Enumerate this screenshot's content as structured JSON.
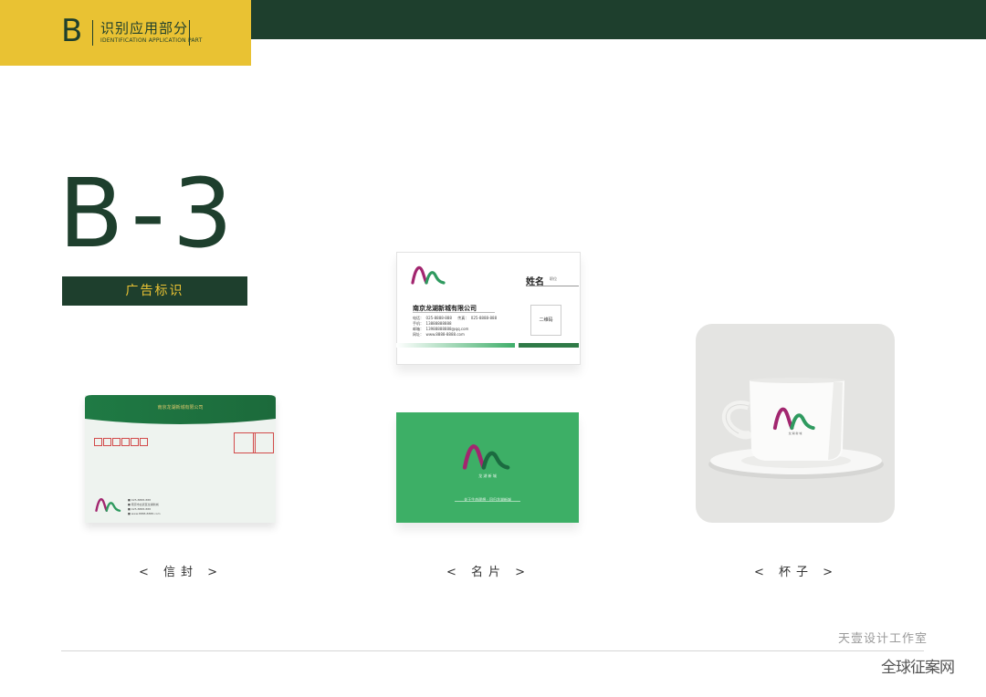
{
  "header": {
    "letter": "B",
    "title": "识别应用部分",
    "subtitle": "IDENTIFICATION APPLICATION PART",
    "colors": {
      "yellow": "#e9c233",
      "dark_green": "#1e3f2d"
    }
  },
  "section": {
    "code": "B-3",
    "label": "广告标识"
  },
  "envelope": {
    "flap_text": "南京龙湖新城有限公司",
    "stamp_box_count": 6,
    "info_lines": [
      "■ 025-8888-888",
      "■ 南京市玄武区龙湖新城",
      "■ 025-8888-888",
      "■ www.8888-8888.com"
    ]
  },
  "card_front": {
    "name": "姓名",
    "role": "职位",
    "company": "南京龙湖新城有限公司",
    "info": "电话：  025-8888-888     传真：  025-8888-888\n手机：  13888888888\n邮箱：  13988888888@qq.com\n网址：  www.8888-8888.com",
    "qr_label": "二维码"
  },
  "card_back": {
    "slogan": "关于生态理想 · 回归龙湖新城"
  },
  "logo": {
    "tagline": "龙 湖 新 城",
    "colors": {
      "magenta": "#a2266f",
      "green": "#2f9a5f",
      "dark_green": "#1b6b40"
    }
  },
  "captions": {
    "envelope": "< 信封 >",
    "card": "< 名片 >",
    "cup": "< 杯子 >"
  },
  "footer": {
    "studio": "天壹设计工作室",
    "watermark": "全球征案网"
  }
}
